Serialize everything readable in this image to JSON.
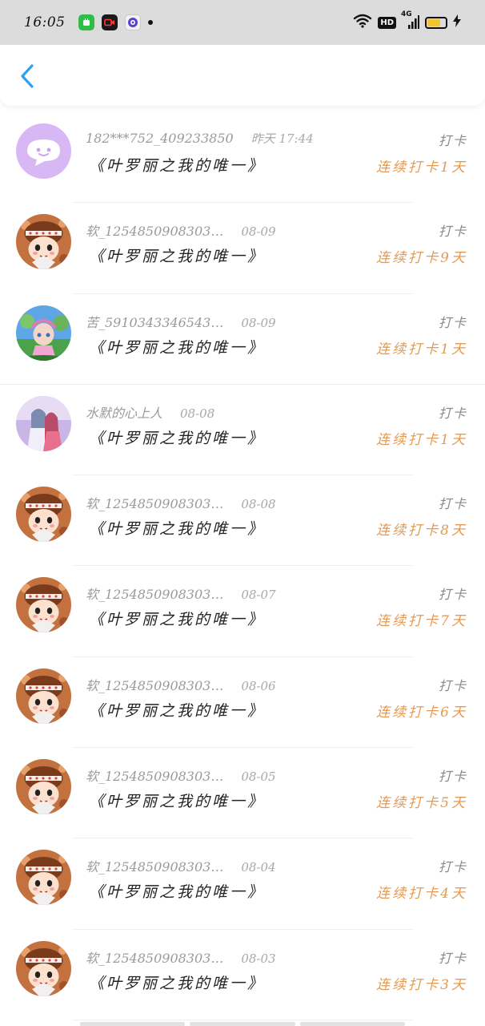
{
  "status_bar": {
    "time": "16:05",
    "network": "4G",
    "hd_label": "HD",
    "battery_level": 0.72,
    "colors": {
      "app1": "#2fbf48",
      "app2": "#1a1a1a",
      "battery_fill": "#f1c232"
    }
  },
  "nav": {
    "back_icon": "chevron-left-icon",
    "accent": "#2ea1f3"
  },
  "items": [
    {
      "username": "182***752_409233850",
      "time": "昨天 17:44",
      "title": "《叶罗丽之我的唯一》",
      "action": "打卡",
      "streak": "连续打卡1天",
      "avatar": "purple-chat-bubble-avatar"
    },
    {
      "username": "软_1254850908303…",
      "time": "08-09",
      "title": "《叶罗丽之我的唯一》",
      "action": "打卡",
      "streak": "连续打卡9天",
      "avatar": "cartoon-girl-avatar"
    },
    {
      "username": "苦_5910343346543…",
      "time": "08-09",
      "title": "《叶罗丽之我的唯一》",
      "action": "打卡",
      "streak": "连续打卡1天",
      "avatar": "doll-scene-avatar"
    },
    {
      "username": "水默的心上人",
      "time": "08-08",
      "title": "《叶罗丽之我的唯一》",
      "action": "打卡",
      "streak": "连续打卡1天",
      "avatar": "anime-couple-avatar"
    },
    {
      "username": "软_1254850908303…",
      "time": "08-08",
      "title": "《叶罗丽之我的唯一》",
      "action": "打卡",
      "streak": "连续打卡8天",
      "avatar": "cartoon-girl-avatar"
    },
    {
      "username": "软_1254850908303…",
      "time": "08-07",
      "title": "《叶罗丽之我的唯一》",
      "action": "打卡",
      "streak": "连续打卡7天",
      "avatar": "cartoon-girl-avatar"
    },
    {
      "username": "软_1254850908303…",
      "time": "08-06",
      "title": "《叶罗丽之我的唯一》",
      "action": "打卡",
      "streak": "连续打卡6天",
      "avatar": "cartoon-girl-avatar"
    },
    {
      "username": "软_1254850908303…",
      "time": "08-05",
      "title": "《叶罗丽之我的唯一》",
      "action": "打卡",
      "streak": "连续打卡5天",
      "avatar": "cartoon-girl-avatar"
    },
    {
      "username": "软_1254850908303…",
      "time": "08-04",
      "title": "《叶罗丽之我的唯一》",
      "action": "打卡",
      "streak": "连续打卡4天",
      "avatar": "cartoon-girl-avatar"
    },
    {
      "username": "软_1254850908303…",
      "time": "08-03",
      "title": "《叶罗丽之我的唯一》",
      "action": "打卡",
      "streak": "连续打卡3天",
      "avatar": "cartoon-girl-avatar"
    }
  ],
  "colors": {
    "streak": "#e49a52",
    "username": "#9a9a9a",
    "title": "#222222"
  }
}
